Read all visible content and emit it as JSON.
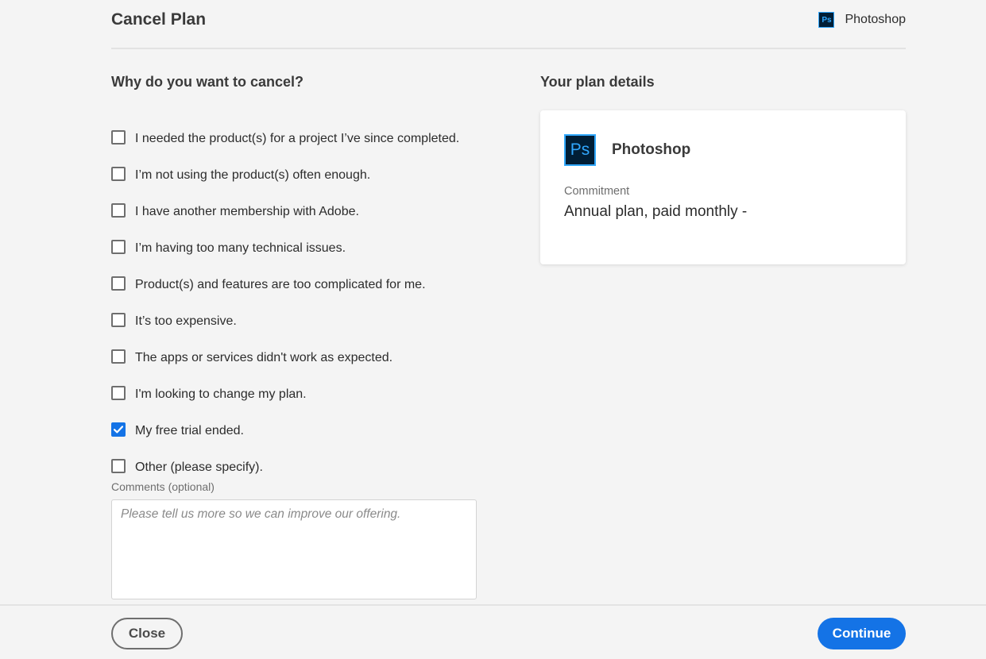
{
  "header": {
    "title": "Cancel Plan",
    "product_icon_text": "Ps",
    "product_name": "Photoshop"
  },
  "reasons_section": {
    "title": "Why do you want to cancel?",
    "options": [
      {
        "label": "I needed the product(s) for a project I’ve since completed.",
        "checked": false
      },
      {
        "label": "I’m not using the product(s) often enough.",
        "checked": false
      },
      {
        "label": "I have another membership with Adobe.",
        "checked": false
      },
      {
        "label": "I’m having too many technical issues.",
        "checked": false
      },
      {
        "label": "Product(s) and features are too complicated for me.",
        "checked": false
      },
      {
        "label": "It’s too expensive.",
        "checked": false
      },
      {
        "label": "The apps or services didn't work as expected.",
        "checked": false
      },
      {
        "label": "I'm looking to change my plan.",
        "checked": false
      },
      {
        "label": "My free trial ended.",
        "checked": true
      },
      {
        "label": "Other (please specify).",
        "checked": false
      }
    ]
  },
  "comments": {
    "label": "Comments (optional)",
    "value": "",
    "placeholder": "Please tell us more so we can improve our offering."
  },
  "plan_details": {
    "title": "Your plan details",
    "product_icon_text": "Ps",
    "product_name": "Photoshop",
    "commitment_label": "Commitment",
    "commitment_value": "Annual plan, paid monthly -"
  },
  "footer": {
    "close_label": "Close",
    "continue_label": "Continue"
  },
  "colors": {
    "accent": "#1473e6",
    "photoshop_blue": "#31a8ff",
    "photoshop_bg": "#001e36",
    "page_background": "#f4f4f4"
  },
  "icons": {
    "product_icon": "photoshop-icon",
    "check": "checkmark-icon"
  }
}
